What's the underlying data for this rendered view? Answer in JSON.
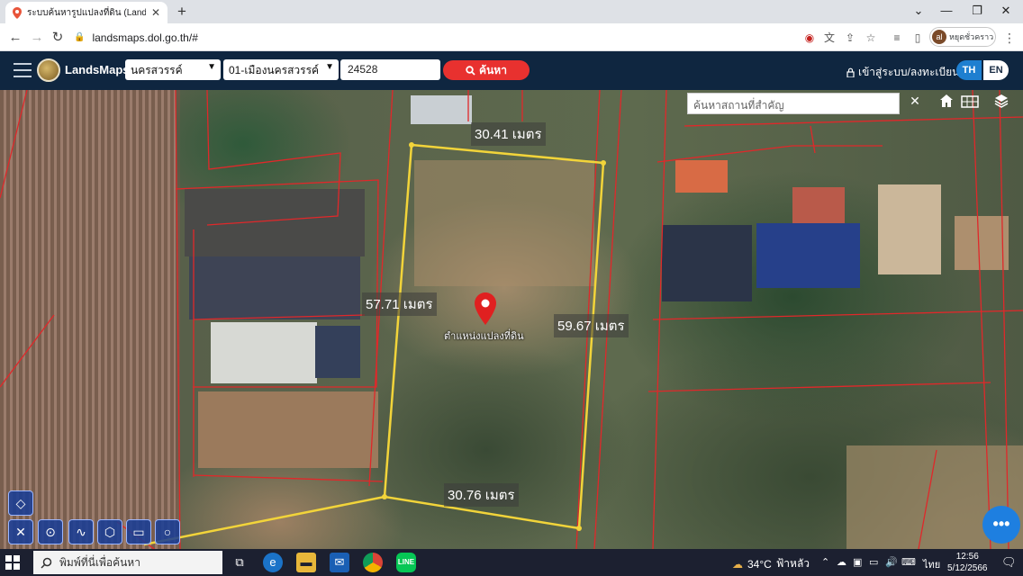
{
  "browser": {
    "tab_title": "ระบบค้นหารูปแปลงที่ดิน (LandsMaps)",
    "url": "landsmaps.dol.go.th/#",
    "profile_name": "หยุดชั่วคราว",
    "profile_initial": "al"
  },
  "app": {
    "brand": "LandsMaps",
    "province": "นครสวรรค์",
    "district": "01-เมืองนครสวรรค์",
    "parcel_number": "24528",
    "search_label": "ค้นหา",
    "login_label": "เข้าสู่ระบบ/ลงทะเบียน",
    "lang_th": "TH",
    "lang_en": "EN"
  },
  "map": {
    "place_search_placeholder": "ค้นหาสถานที่สำคัญ",
    "clear_symbol": "✕",
    "distances": {
      "top": "30.41 เมตร",
      "left": "57.71 เมตร",
      "right": "59.67 เมตร",
      "bottom": "30.76 เมตร"
    },
    "marker_label": "ตำแหน่งแปลงที่ดิน",
    "fab_symbol": "•••"
  },
  "taskbar": {
    "search_placeholder": "พิมพ์ที่นี่เพื่อค้นหา",
    "weather_temp": "34°C",
    "weather_desc": "ฟ้าหลัว",
    "lang": "ไทย",
    "time": "12:56",
    "date": "5/12/2566"
  },
  "colors": {
    "app_header": "#0f2640",
    "search_button": "#e8312f",
    "accent_blue": "#1e7fd0",
    "parcel_outline": "#f2d43a",
    "boundary_lines": "#e0282a",
    "marker": "#e02020"
  }
}
